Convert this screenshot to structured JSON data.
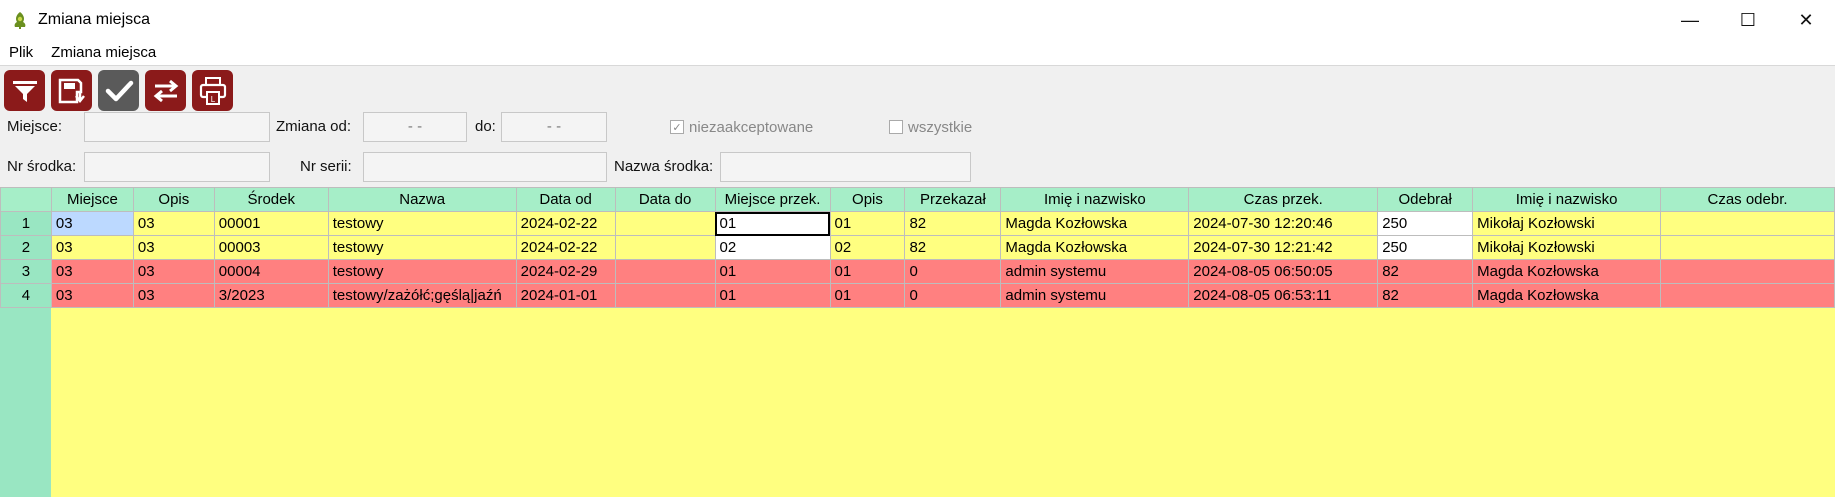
{
  "window": {
    "title": "Zmiana miejsca",
    "controls": [
      "—",
      "☐",
      "✕"
    ]
  },
  "menu": [
    "Plik",
    "Zmiana miejsca"
  ],
  "toolbar": {
    "buttons": [
      {
        "name": "filter-button",
        "icon": "filter-icon",
        "color": "#8b1a1a"
      },
      {
        "name": "save-button",
        "icon": "save-icon",
        "color": "#8b1a1a"
      },
      {
        "name": "accept-button",
        "icon": "check-icon",
        "color": "#5a5a5a"
      },
      {
        "name": "swap-button",
        "icon": "swap-arrows-icon",
        "color": "#8b1a1a"
      },
      {
        "name": "print-button",
        "icon": "printer-icon",
        "color": "#8b1a1a"
      }
    ]
  },
  "filters": {
    "miejsce_label": "Miejsce:",
    "miejsce_value": "",
    "zmiana_od_label": "Zmiana od:",
    "zmiana_od_value": "- -",
    "do_label": "do:",
    "do_value": "- -",
    "niezaakceptowane_label": "niezaakceptowane",
    "niezaakceptowane_checked": true,
    "wszystkie_label": "wszystkie",
    "wszystkie_checked": false,
    "nr_srodka_label": "Nr środka:",
    "nr_srodka_value": "",
    "nr_serii_label": "Nr serii:",
    "nr_serii_value": "",
    "nazwa_srodka_label": "Nazwa środka:",
    "nazwa_srodka_value": ""
  },
  "table": {
    "columns": [
      "Miejsce",
      "Opis",
      "Środek",
      "Nazwa",
      "Data od",
      "Data do",
      "Miejsce przek.",
      "Opis",
      "Przekazał",
      "Imię i nazwisko",
      "Czas przek.",
      "Odebrał",
      "Imię i nazwisko",
      "Czas odebr."
    ],
    "rows": [
      {
        "num": "1",
        "status": "yellow",
        "cells": [
          "03",
          "03",
          "00001",
          "testowy",
          "2024-02-22",
          "",
          "01",
          "01",
          "82",
          "Magda Kozłowska",
          "2024-07-30 12:20:46",
          "250",
          "Mikołaj Kozłowski",
          ""
        ]
      },
      {
        "num": "2",
        "status": "yellow",
        "cells": [
          "03",
          "03",
          "00003",
          "testowy",
          "2024-02-22",
          "",
          "02",
          "02",
          "82",
          "Magda Kozłowska",
          "2024-07-30 12:21:42",
          "250",
          "Mikołaj Kozłowski",
          ""
        ]
      },
      {
        "num": "3",
        "status": "red",
        "cells": [
          "03",
          "03",
          "00004",
          "testowy",
          "2024-02-29",
          "",
          "01",
          "01",
          "0",
          "admin systemu",
          "2024-08-05 06:50:05",
          "82",
          "Magda Kozłowska",
          ""
        ]
      },
      {
        "num": "4",
        "status": "red",
        "cells": [
          "03",
          "03",
          "3/2023",
          "testowy/zażółć;gęślą|jaźń",
          "2024-01-01",
          "",
          "01",
          "01",
          "0",
          "admin systemu",
          "2024-08-05 06:53:11",
          "82",
          "Magda Kozłowska",
          ""
        ]
      }
    ]
  },
  "colors": {
    "row_yellow": "#ffff80",
    "row_red": "#ff8080",
    "header_green": "#a6eec8",
    "selected_cell": "#bcd9ff"
  }
}
